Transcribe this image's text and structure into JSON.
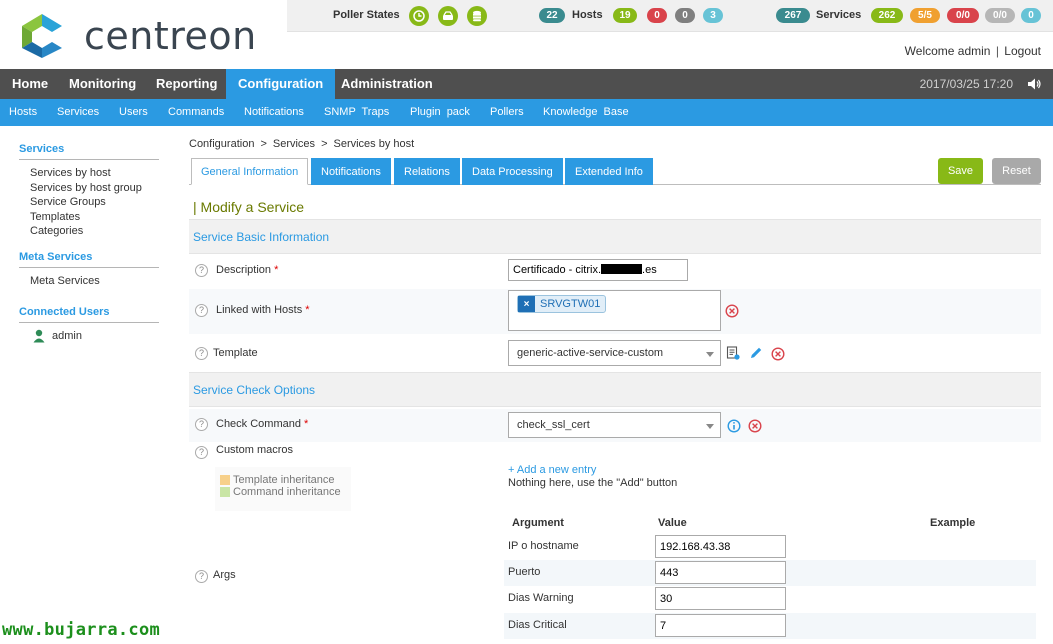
{
  "brand": {
    "name": "centreon",
    "logo_colors": [
      "#2aa3d8",
      "#8bc53f",
      "#1b6aa5"
    ]
  },
  "statusbar": {
    "poller_label": "Poller States",
    "poller_icons": [
      "clock-icon",
      "database-server-icon",
      "storage-icon"
    ],
    "hosts": {
      "label": "Hosts",
      "total": "22",
      "up": "19",
      "down": "0",
      "unreachable": "0",
      "pending": "3"
    },
    "services": {
      "label": "Services",
      "total": "267",
      "ok": "262",
      "warning": "5/5",
      "critical": "0/0",
      "unknown": "0/0",
      "pending": "0"
    }
  },
  "header": {
    "welcome": "Welcome admin",
    "separator": "|",
    "logout": "Logout",
    "datetime": "2017/03/25 17:20"
  },
  "mainnav": [
    "Home",
    "Monitoring",
    "Reporting",
    "Configuration",
    "Administration"
  ],
  "subnav": [
    "Hosts",
    "Services",
    "Users",
    "Commands",
    "Notifications",
    "SNMP  Traps",
    "Plugin  pack",
    "Pollers",
    "Knowledge  Base"
  ],
  "sidebar": {
    "services": {
      "title": "Services",
      "items": [
        "Services by host",
        "Services by host group",
        "Service Groups",
        "Templates",
        "Categories"
      ]
    },
    "meta": {
      "title": "Meta Services",
      "items": [
        "Meta Services"
      ]
    },
    "users": {
      "title": "Connected Users",
      "items": [
        "admin"
      ]
    }
  },
  "breadcrumb": [
    "Configuration",
    "Services",
    "Services by host"
  ],
  "breadcrumb_sep": ">",
  "tabs": [
    "General Information",
    "Notifications",
    "Relations",
    "Data Processing",
    "Extended Info"
  ],
  "buttons": {
    "save": "Save",
    "reset": "Reset"
  },
  "page_title": "| Modify a Service",
  "sections": {
    "basic": "Service Basic Information",
    "check": "Service Check Options"
  },
  "help_glyph": "?",
  "required_mark": "*",
  "form": {
    "description": {
      "label": "Description",
      "value_prefix": "Certificado - citrix.",
      "value_suffix": ".es"
    },
    "linked_hosts": {
      "label": "Linked with Hosts",
      "chip": "SRVGTW01",
      "chip_remove": "×"
    },
    "template": {
      "label": "Template",
      "value": "generic-active-service-custom"
    },
    "check_command": {
      "label": "Check Command",
      "value": "check_ssl_cert"
    },
    "custom_macros": {
      "label": "Custom macros",
      "legend": [
        {
          "label": "Template inheritance",
          "color": "#f7d08a"
        },
        {
          "label": "Command inheritance",
          "color": "#c9e5a5"
        }
      ],
      "add_link": "+ Add a new entry",
      "empty": "Nothing here, use the \"Add\" button"
    },
    "args": {
      "label": "Args",
      "headers": [
        "Argument",
        "Value",
        "Example"
      ],
      "rows": [
        {
          "name": "IP o hostname",
          "value": "192.168.43.38"
        },
        {
          "name": "Puerto",
          "value": "443"
        },
        {
          "name": "Dias Warning",
          "value": "30"
        },
        {
          "name": "Dias Critical",
          "value": "7"
        }
      ]
    }
  },
  "colors": {
    "accent": "#2b9ae2",
    "green": "#88b917",
    "nav_dark": "#4f4f4f",
    "remove_red": "#d9434b"
  },
  "watermark": "www.bujarra.com"
}
